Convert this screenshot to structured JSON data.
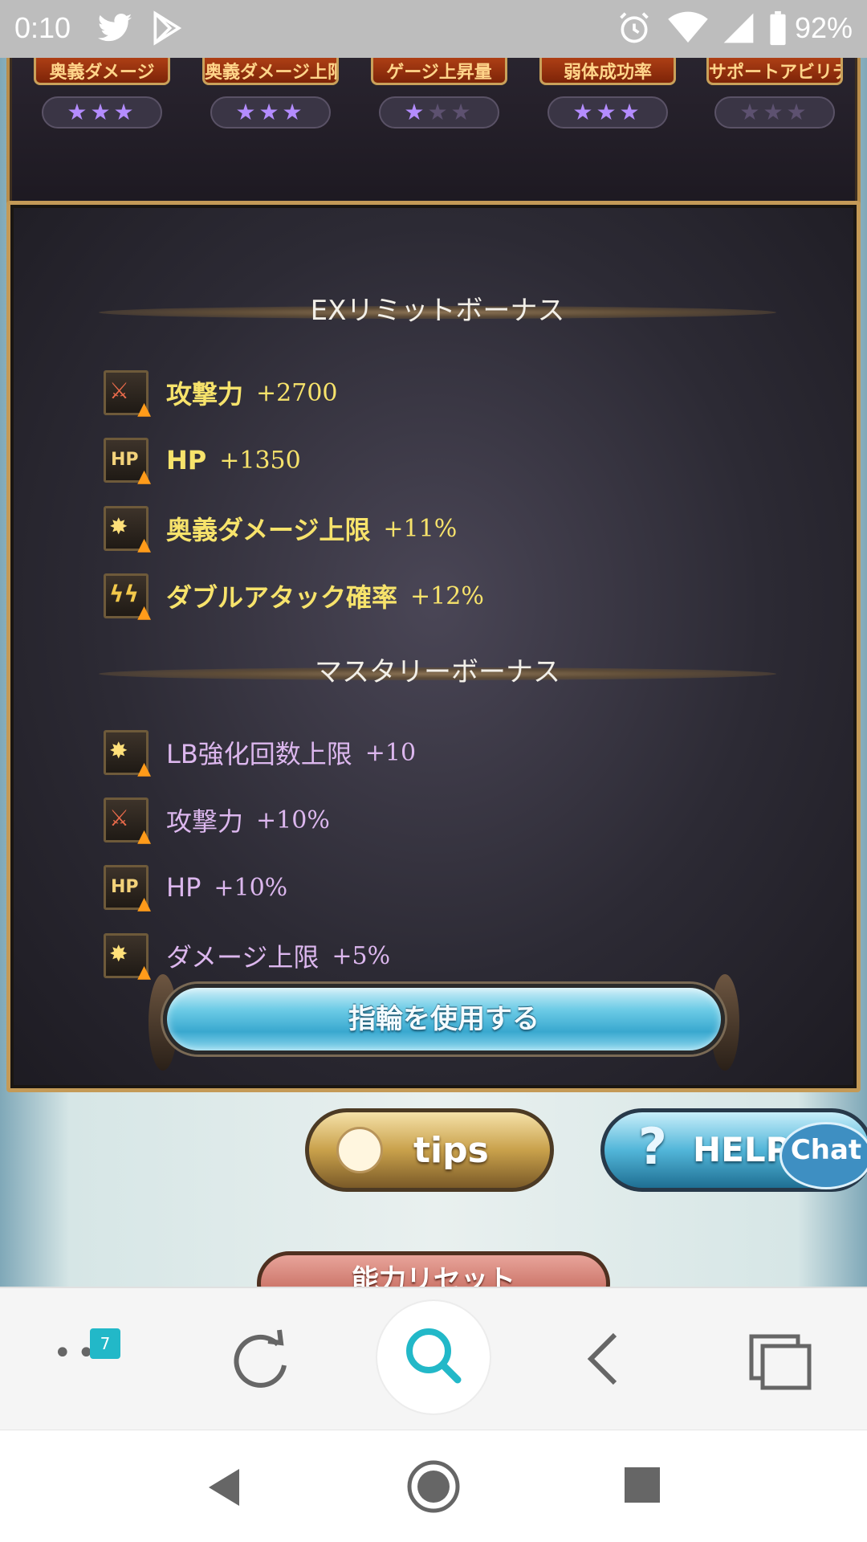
{
  "status_bar": {
    "time": "0:10",
    "battery_percent": "92%",
    "icons": [
      "twitter-icon",
      "play-store-icon",
      "alarm-icon",
      "wifi-icon",
      "signal-icon",
      "battery-icon"
    ]
  },
  "skill_slots": [
    {
      "label": "奥義ダメージ",
      "stars_filled": 3,
      "stars_total": 3
    },
    {
      "label": "奥義ダメージ上限",
      "stars_filled": 3,
      "stars_total": 3
    },
    {
      "label": "ゲージ上昇量",
      "stars_filled": 1,
      "stars_total": 3
    },
    {
      "label": "弱体成功率",
      "stars_filled": 3,
      "stars_total": 3
    },
    {
      "label": "サポートアビリティ",
      "stars_filled": 0,
      "stars_total": 3
    }
  ],
  "ex_limit": {
    "title": "EXリミットボーナス",
    "items": [
      {
        "icon": "attack-up-icon",
        "name": "攻撃力",
        "value": "+2700"
      },
      {
        "icon": "hp-up-icon",
        "name": "HP",
        "value": "+1350"
      },
      {
        "icon": "ougi-cap-up-icon",
        "name": "奥義ダメージ上限",
        "value": "+11%"
      },
      {
        "icon": "double-attack-up-icon",
        "name": "ダブルアタック確率",
        "value": "+12%"
      }
    ]
  },
  "mastery": {
    "title": "マスタリーボーナス",
    "items": [
      {
        "icon": "lb-cap-up-icon",
        "name": "LB強化回数上限",
        "value": "+10"
      },
      {
        "icon": "attack-up-icon",
        "name": "攻撃力",
        "value": "+10%"
      },
      {
        "icon": "hp-up-icon",
        "name": "HP",
        "value": "+10%"
      },
      {
        "icon": "damage-cap-up-icon",
        "name": "ダメージ上限",
        "value": "+5%"
      }
    ]
  },
  "buttons": {
    "use_ring": "指輪を使用する",
    "tips": "tips",
    "help": "HELP",
    "chat": "Chat",
    "reset": "能力リセット"
  },
  "browser": {
    "tab_count": "7",
    "accent_color": "#22b8c8"
  },
  "colors": {
    "ex_text": "#f7e36b",
    "mastery_text": "#dcb7ee",
    "panel_border": "#c49a57"
  }
}
